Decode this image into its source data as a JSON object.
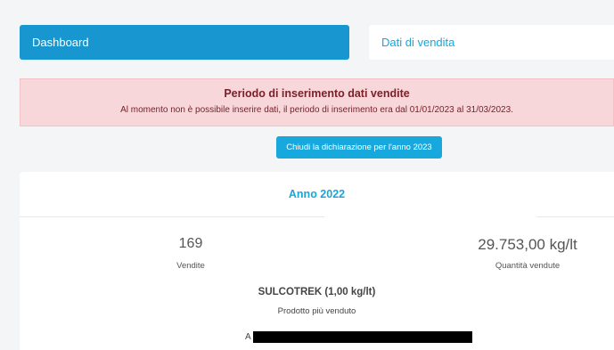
{
  "tabs": {
    "dashboard": "Dashboard",
    "sales_data": "Dati di vendita"
  },
  "alert": {
    "title": "Periodo di inserimento dati vendite",
    "message": "Al momento non è possibile inserire dati, il periodo di inserimento era dal 01/01/2023 al 31/03/2023."
  },
  "close_button": "Chiudi la dichiarazione per l'anno 2023",
  "card": {
    "title": "Anno 2022",
    "sales_count": "169",
    "sales_label": "Vendite",
    "quantity": "29.753,00 kg/lt",
    "quantity_label": "Quantità vendute",
    "top_product": "SULCOTREK (1,00 kg/lt)",
    "top_product_label": "Prodotto più venduto",
    "partial_text": "A"
  },
  "colors": {
    "primary": "#1796cf",
    "accent_text": "#1aa5d8",
    "alert_bg": "#f8d7da",
    "alert_text": "#7a2029"
  }
}
